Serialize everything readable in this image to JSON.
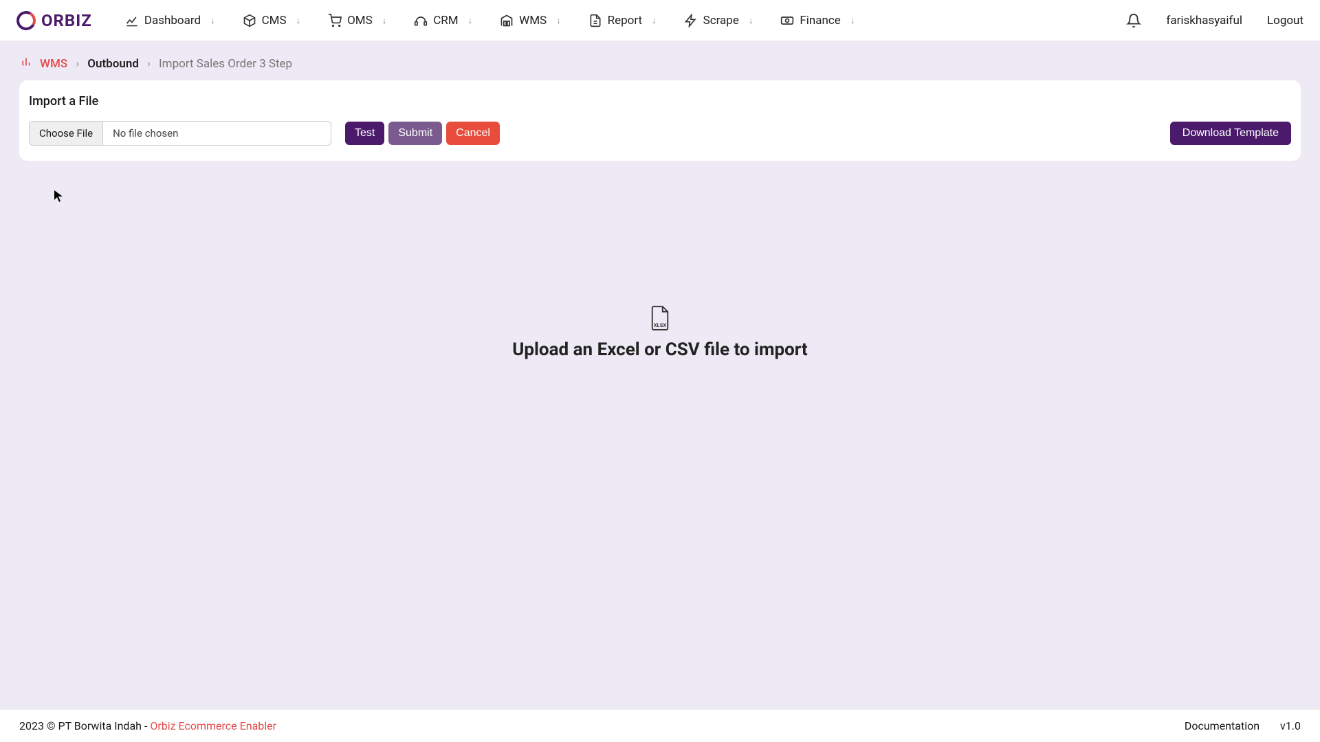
{
  "brand": "ORBIZ",
  "nav": {
    "dashboard": "Dashboard",
    "cms": "CMS",
    "oms": "OMS",
    "crm": "CRM",
    "wms": "WMS",
    "report": "Report",
    "scrape": "Scrape",
    "finance": "Finance"
  },
  "user": {
    "name": "fariskhasyaiful",
    "logout": "Logout"
  },
  "breadcrumb": {
    "wms": "WMS",
    "outbound": "Outbound",
    "page": "Import Sales Order 3 Step"
  },
  "card": {
    "title": "Import a File",
    "choose": "Choose File",
    "nofile": "No file chosen",
    "test": "Test",
    "submit": "Submit",
    "cancel": "Cancel",
    "download": "Download Template"
  },
  "empty": {
    "label": "XLSX",
    "text": "Upload an Excel or CSV file to import"
  },
  "footer": {
    "copyright": "2023 © PT Borwita Indah - ",
    "link": "Orbiz Ecommerce Enabler",
    "doc": "Documentation",
    "version": "v1.0"
  }
}
